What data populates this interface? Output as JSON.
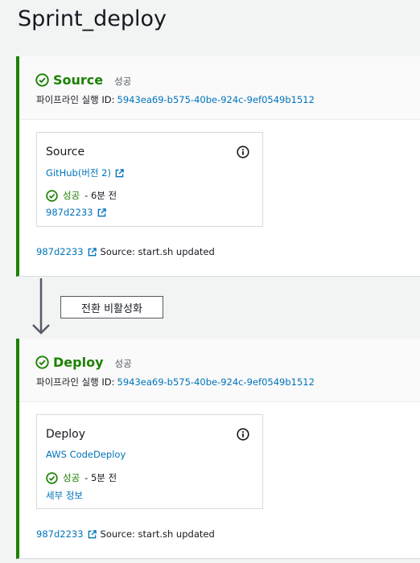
{
  "page": {
    "title": "Sprint_deploy"
  },
  "colors": {
    "success": "#1d8102",
    "link": "#0073bb",
    "stage_border": "#1d8102"
  },
  "stages": [
    {
      "name": "Source",
      "status": "성공",
      "execution_label": "파이프라인 실행 ID:",
      "execution_id": "5943ea69-b575-40be-924c-9ef0549b1512",
      "action": {
        "name": "Source",
        "provider": "GitHub(버전 2)",
        "status": "성공",
        "time": "- 6분 전",
        "link": "987d2233"
      },
      "commit": {
        "id": "987d2233",
        "message": "Source: start.sh updated"
      }
    },
    {
      "name": "Deploy",
      "status": "성공",
      "execution_label": "파이프라인 실행 ID:",
      "execution_id": "5943ea69-b575-40be-924c-9ef0549b1512",
      "action": {
        "name": "Deploy",
        "provider": "AWS CodeDeploy",
        "status": "성공",
        "time": "- 5분 전",
        "link": "세부 정보"
      },
      "commit": {
        "id": "987d2233",
        "message": "Source: start.sh updated"
      }
    }
  ],
  "transition": {
    "button_label": "전환 비활성화"
  }
}
